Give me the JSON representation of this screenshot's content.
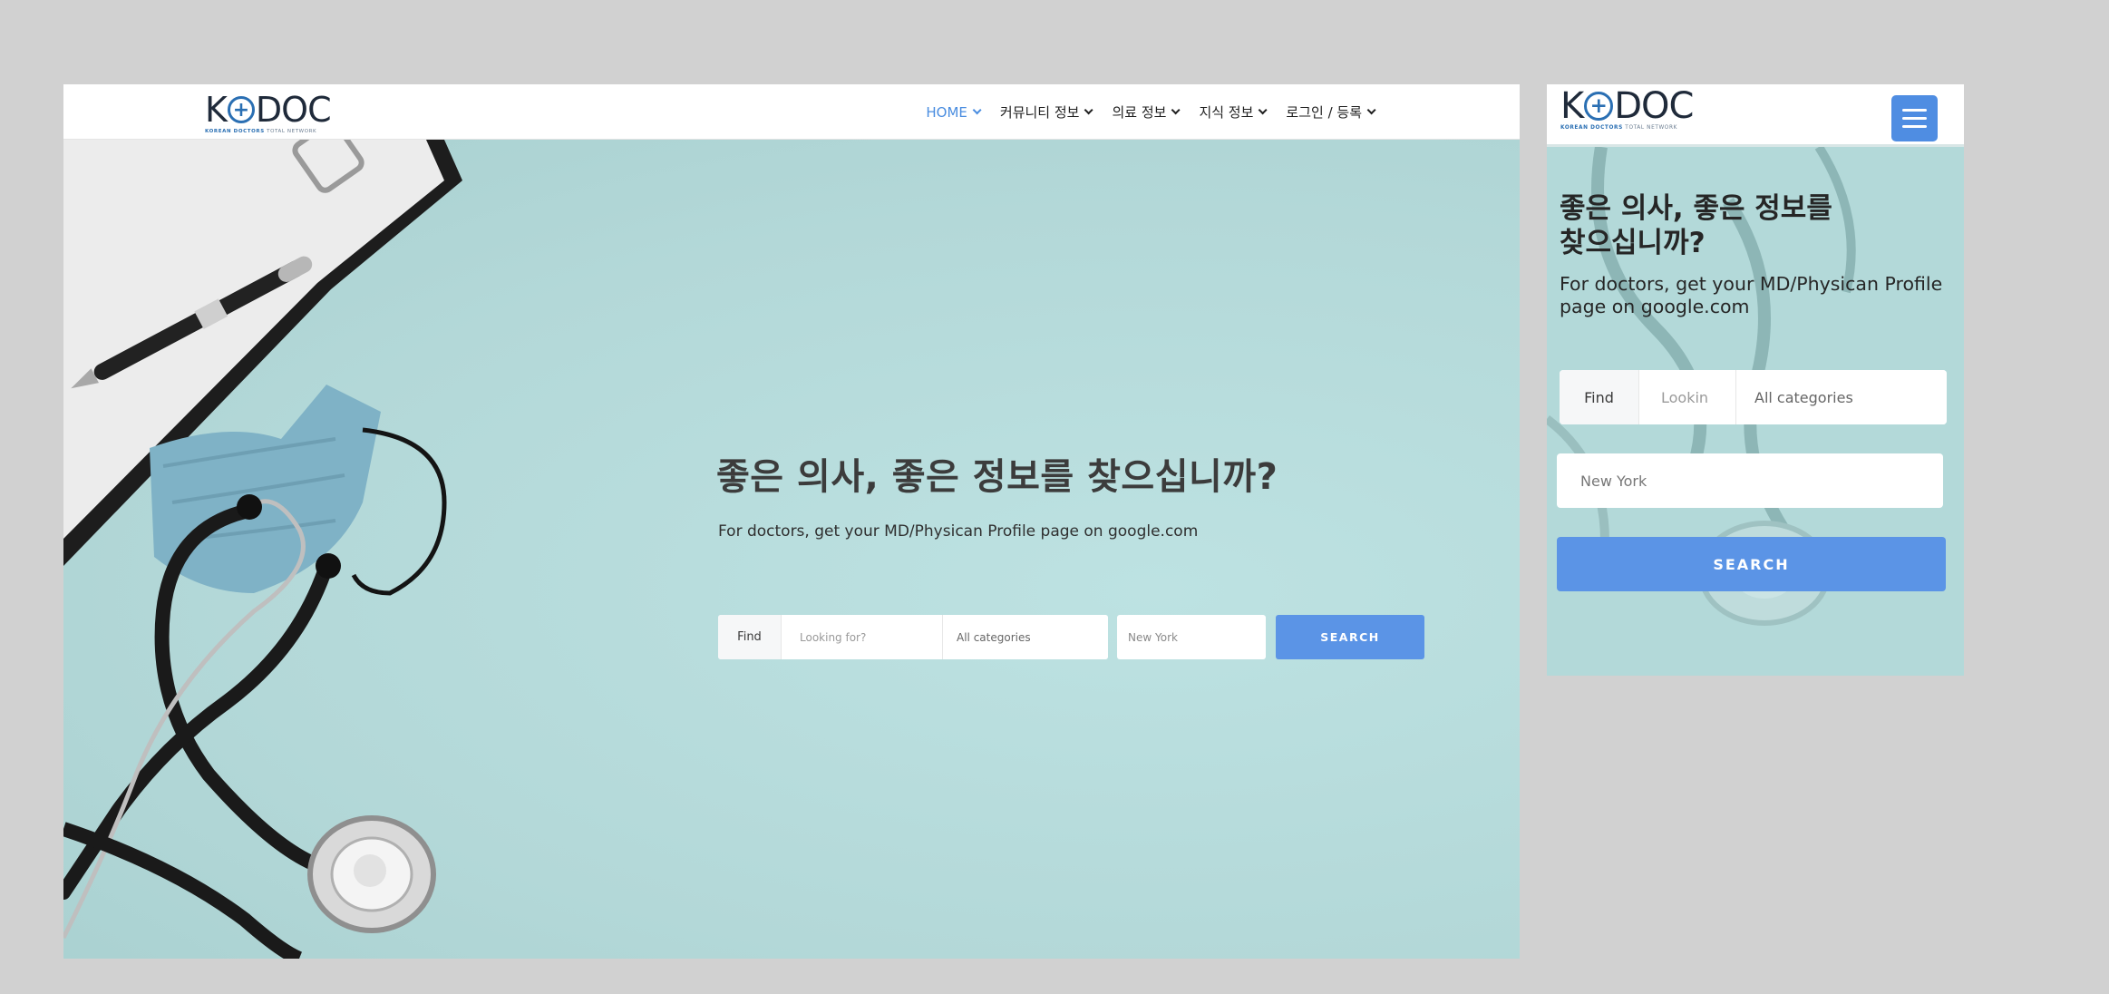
{
  "brand": {
    "logo_left": "K",
    "logo_plus": "+",
    "logo_right": "DOC",
    "tagline_strong": "KOREAN DOCTORS",
    "tagline_rest": " TOTAL NETWORK",
    "accent_color": "#4a8de0",
    "button_color": "#5b94e6"
  },
  "nav": {
    "items": [
      {
        "label": "HOME",
        "active": true
      },
      {
        "label": "커뮤니티 정보"
      },
      {
        "label": "의료 정보"
      },
      {
        "label": "지식 정보"
      },
      {
        "label": "로그인 / 등록"
      }
    ],
    "chevron_icon": "chevron-down-icon",
    "menu_icon": "hamburger-menu-icon"
  },
  "hero": {
    "title": "좋은 의사, 좋은 정보를 찾으십니까?",
    "mobile_title_line1": "좋은 의사, 좋은 정보를",
    "mobile_title_line2": "찾으십니까?",
    "subtitle": "For doctors, get your MD/Physican Profile page on google.com"
  },
  "search": {
    "find_label": "Find",
    "query_placeholder": "Looking for?",
    "mobile_query_placeholder": "Lookin",
    "category_value": "All categories",
    "location_placeholder": "New York",
    "button_label": "SEARCH"
  }
}
